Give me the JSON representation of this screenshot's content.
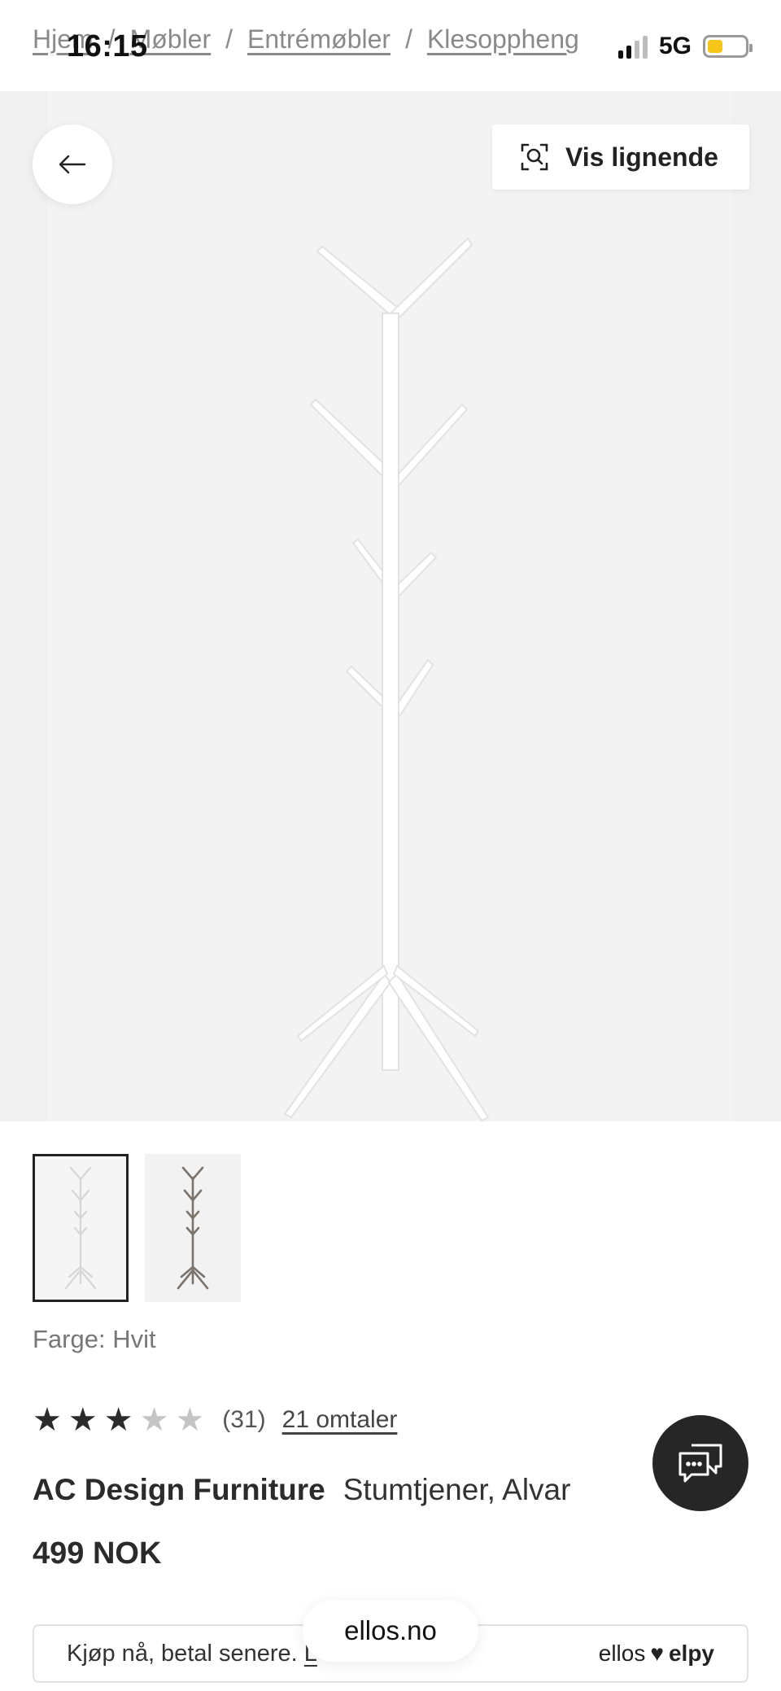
{
  "status_bar": {
    "time": "16:15",
    "network": "5G",
    "battery_level": 0.4
  },
  "breadcrumb": {
    "items": [
      "Hjem",
      "Møbler",
      "Entrémøbler",
      "Klesoppheng"
    ],
    "separator": "/"
  },
  "hero": {
    "similar_button_label": "Vis lignende"
  },
  "colors": {
    "accent": "#2b2b2b",
    "hero_bg": "#f0f0f0",
    "star_off": "#c4c4c4",
    "battery": "#f5c518"
  },
  "product": {
    "color_label": "Farge: Hvit",
    "rating": {
      "value": 3,
      "max": 5,
      "count": "(31)",
      "reviews_link": "21 omtaler"
    },
    "brand": "AC Design Furniture",
    "name": "Stumtjener, Alvar",
    "price": "499 NOK"
  },
  "thumbnails": [
    {
      "variant": "white",
      "selected": true
    },
    {
      "variant": "grey",
      "selected": false
    }
  ],
  "banner": {
    "text": "Kjøp nå, betal senere.",
    "link": "L",
    "logo_left": "ellos",
    "logo_right": "elpy"
  },
  "browser": {
    "url": "ellos.no"
  }
}
